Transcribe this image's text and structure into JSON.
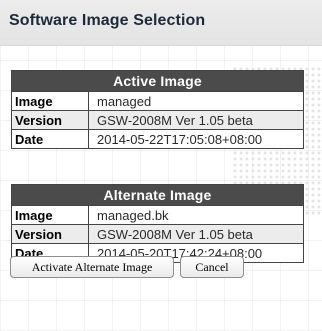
{
  "page": {
    "title": "Software Image Selection"
  },
  "active_image": {
    "header": "Active Image",
    "rows": [
      {
        "label": "Image",
        "value": "managed"
      },
      {
        "label": "Version",
        "value": "GSW-2008M Ver 1.05 beta"
      },
      {
        "label": "Date",
        "value": "2014-05-22T17:05:08+08:00"
      }
    ]
  },
  "alternate_image": {
    "header": "Alternate Image",
    "rows": [
      {
        "label": "Image",
        "value": "managed.bk"
      },
      {
        "label": "Version",
        "value": "GSW-2008M Ver 1.05 beta"
      },
      {
        "label": "Date",
        "value": "2014-05-20T17:42:24+08:00"
      }
    ]
  },
  "buttons": {
    "activate_label": "Activate Alternate Image",
    "cancel_label": "Cancel"
  },
  "colors": {
    "table_header_bg": "#4b4b4b",
    "title_text": "#1d2a3a",
    "title_bar_bg": "#e8e8e8"
  }
}
